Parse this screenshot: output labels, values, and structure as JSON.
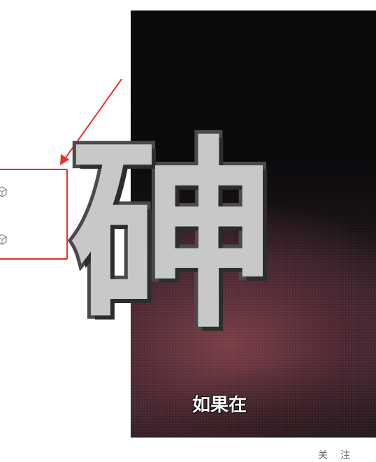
{
  "video": {
    "title_glyphs": "砷",
    "subtitle": "如果在"
  },
  "bottom": {
    "partial_text": "关注"
  },
  "annotation": {
    "arrow_color": "#e8322a",
    "box_color": "#e8322a"
  },
  "icons": [
    "cube-icon",
    "cube-icon"
  ]
}
